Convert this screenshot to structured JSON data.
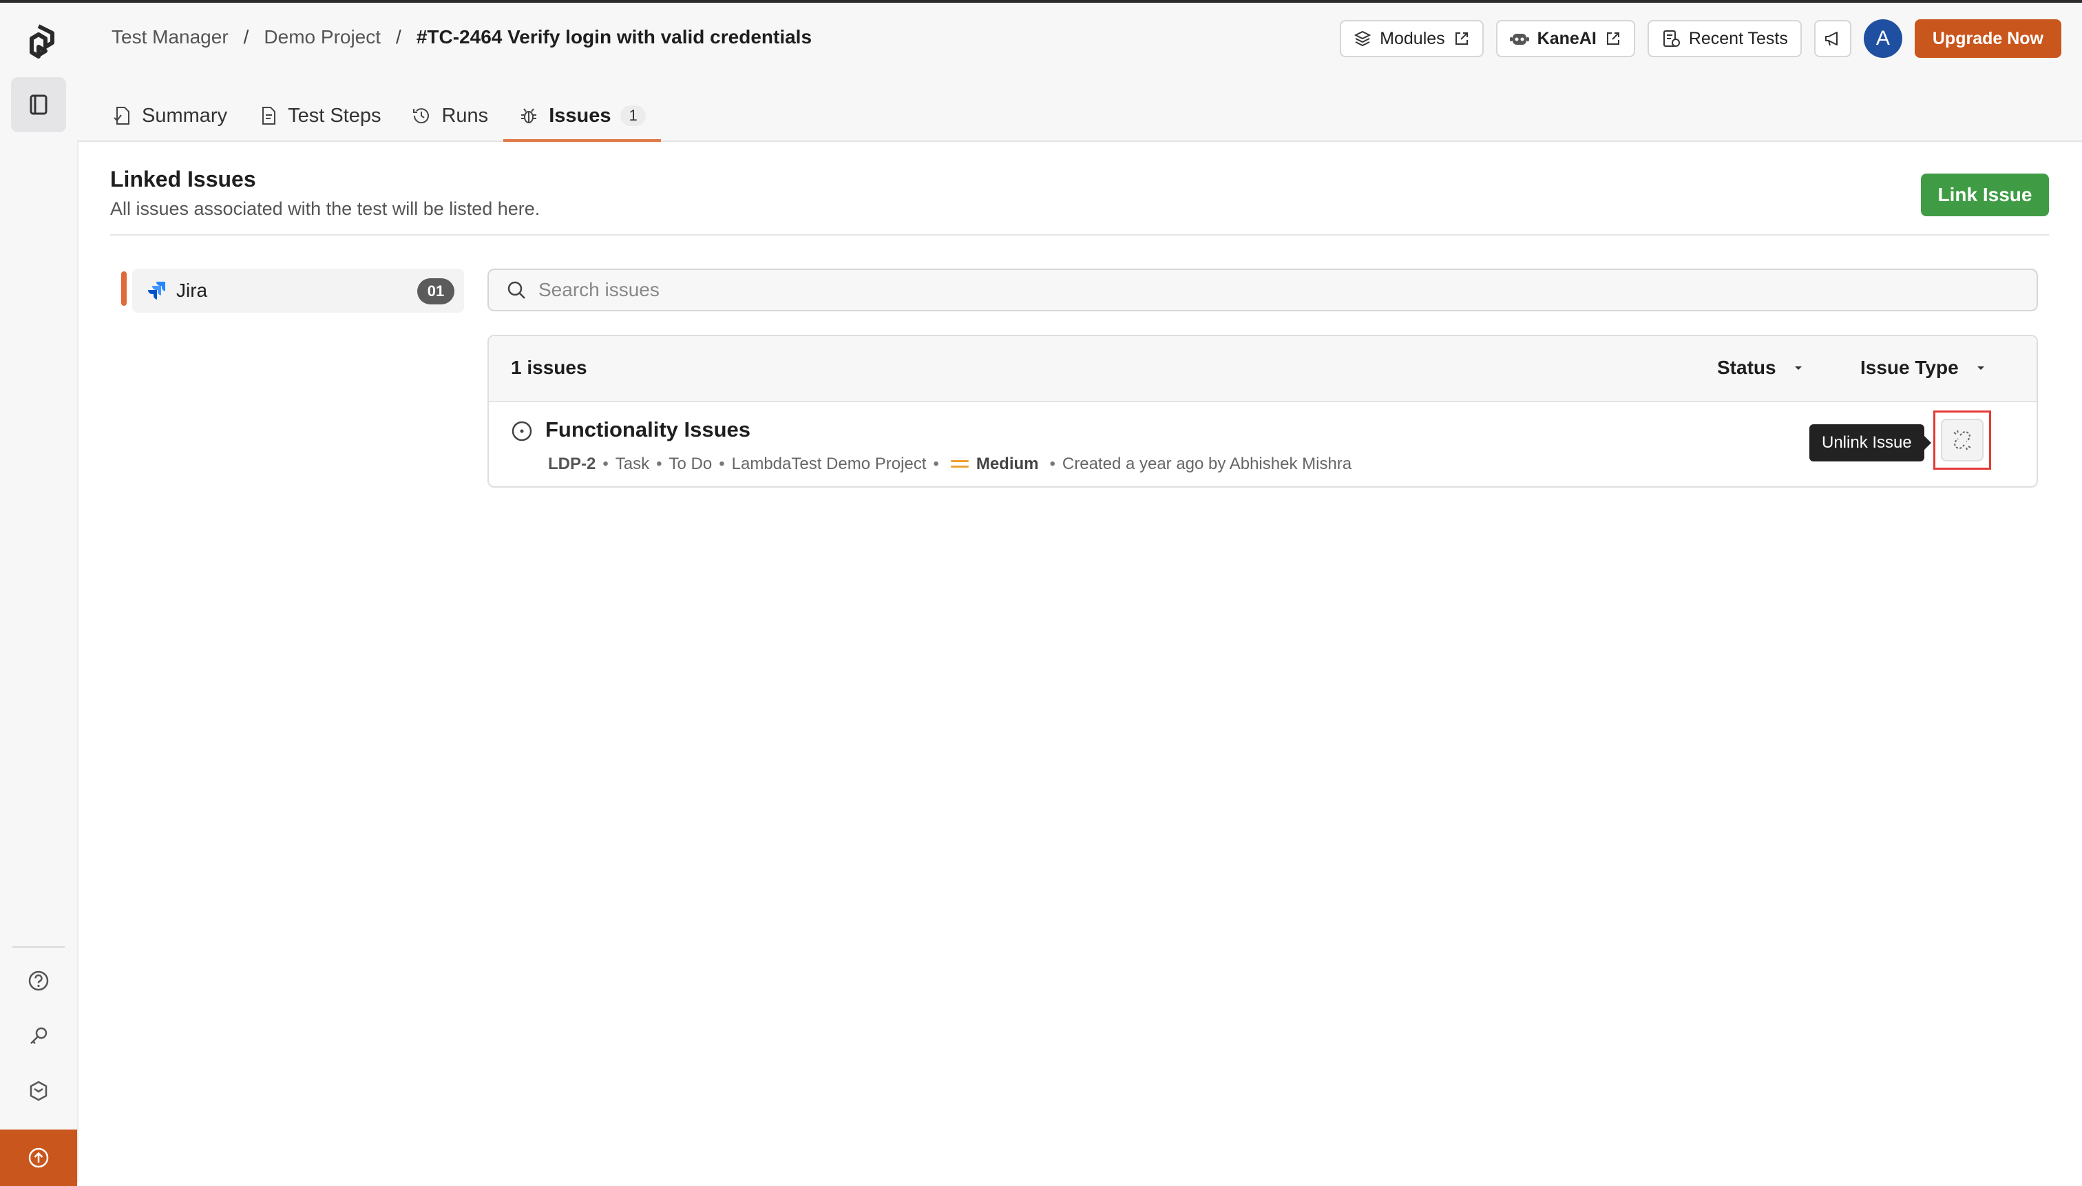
{
  "breadcrumb": {
    "items": [
      "Test Manager",
      "Demo Project"
    ],
    "separator": "/",
    "current": "#TC-2464 Verify login with valid credentials"
  },
  "header_buttons": {
    "modules": "Modules",
    "kaneai": "KaneAI",
    "recent_tests": "Recent Tests",
    "avatar_initial": "A",
    "upgrade": "Upgrade Now"
  },
  "tabs": [
    {
      "label": "Summary",
      "icon": "summary-icon"
    },
    {
      "label": "Test Steps",
      "icon": "test-steps-icon"
    },
    {
      "label": "Runs",
      "icon": "history-icon"
    },
    {
      "label": "Issues",
      "icon": "bug-icon",
      "count": "1",
      "active": true
    }
  ],
  "section": {
    "title": "Linked Issues",
    "subtitle": "All issues associated with the test will be listed here.",
    "link_button": "Link Issue"
  },
  "integrations": [
    {
      "label": "Jira",
      "count": "01",
      "icon": "jira-icon"
    }
  ],
  "search": {
    "placeholder": "Search issues"
  },
  "issues_panel": {
    "count_label": "1 issues",
    "filters": [
      "Status",
      "Issue Type"
    ],
    "issues": [
      {
        "title": "Functionality Issues",
        "key": "LDP-2",
        "type": "Task",
        "status": "To Do",
        "project": "LambdaTest Demo Project",
        "priority": "Medium",
        "created": "Created a year ago by Abhishek Mishra"
      }
    ],
    "tooltip": "Unlink Issue"
  },
  "colors": {
    "accent": "#c9561c",
    "link_button": "#3f9c45",
    "active_tab": "#e07a4a",
    "priority_medium": "#f0a030",
    "highlight_box": "#e53935",
    "jira_blue": "#2684ff"
  }
}
